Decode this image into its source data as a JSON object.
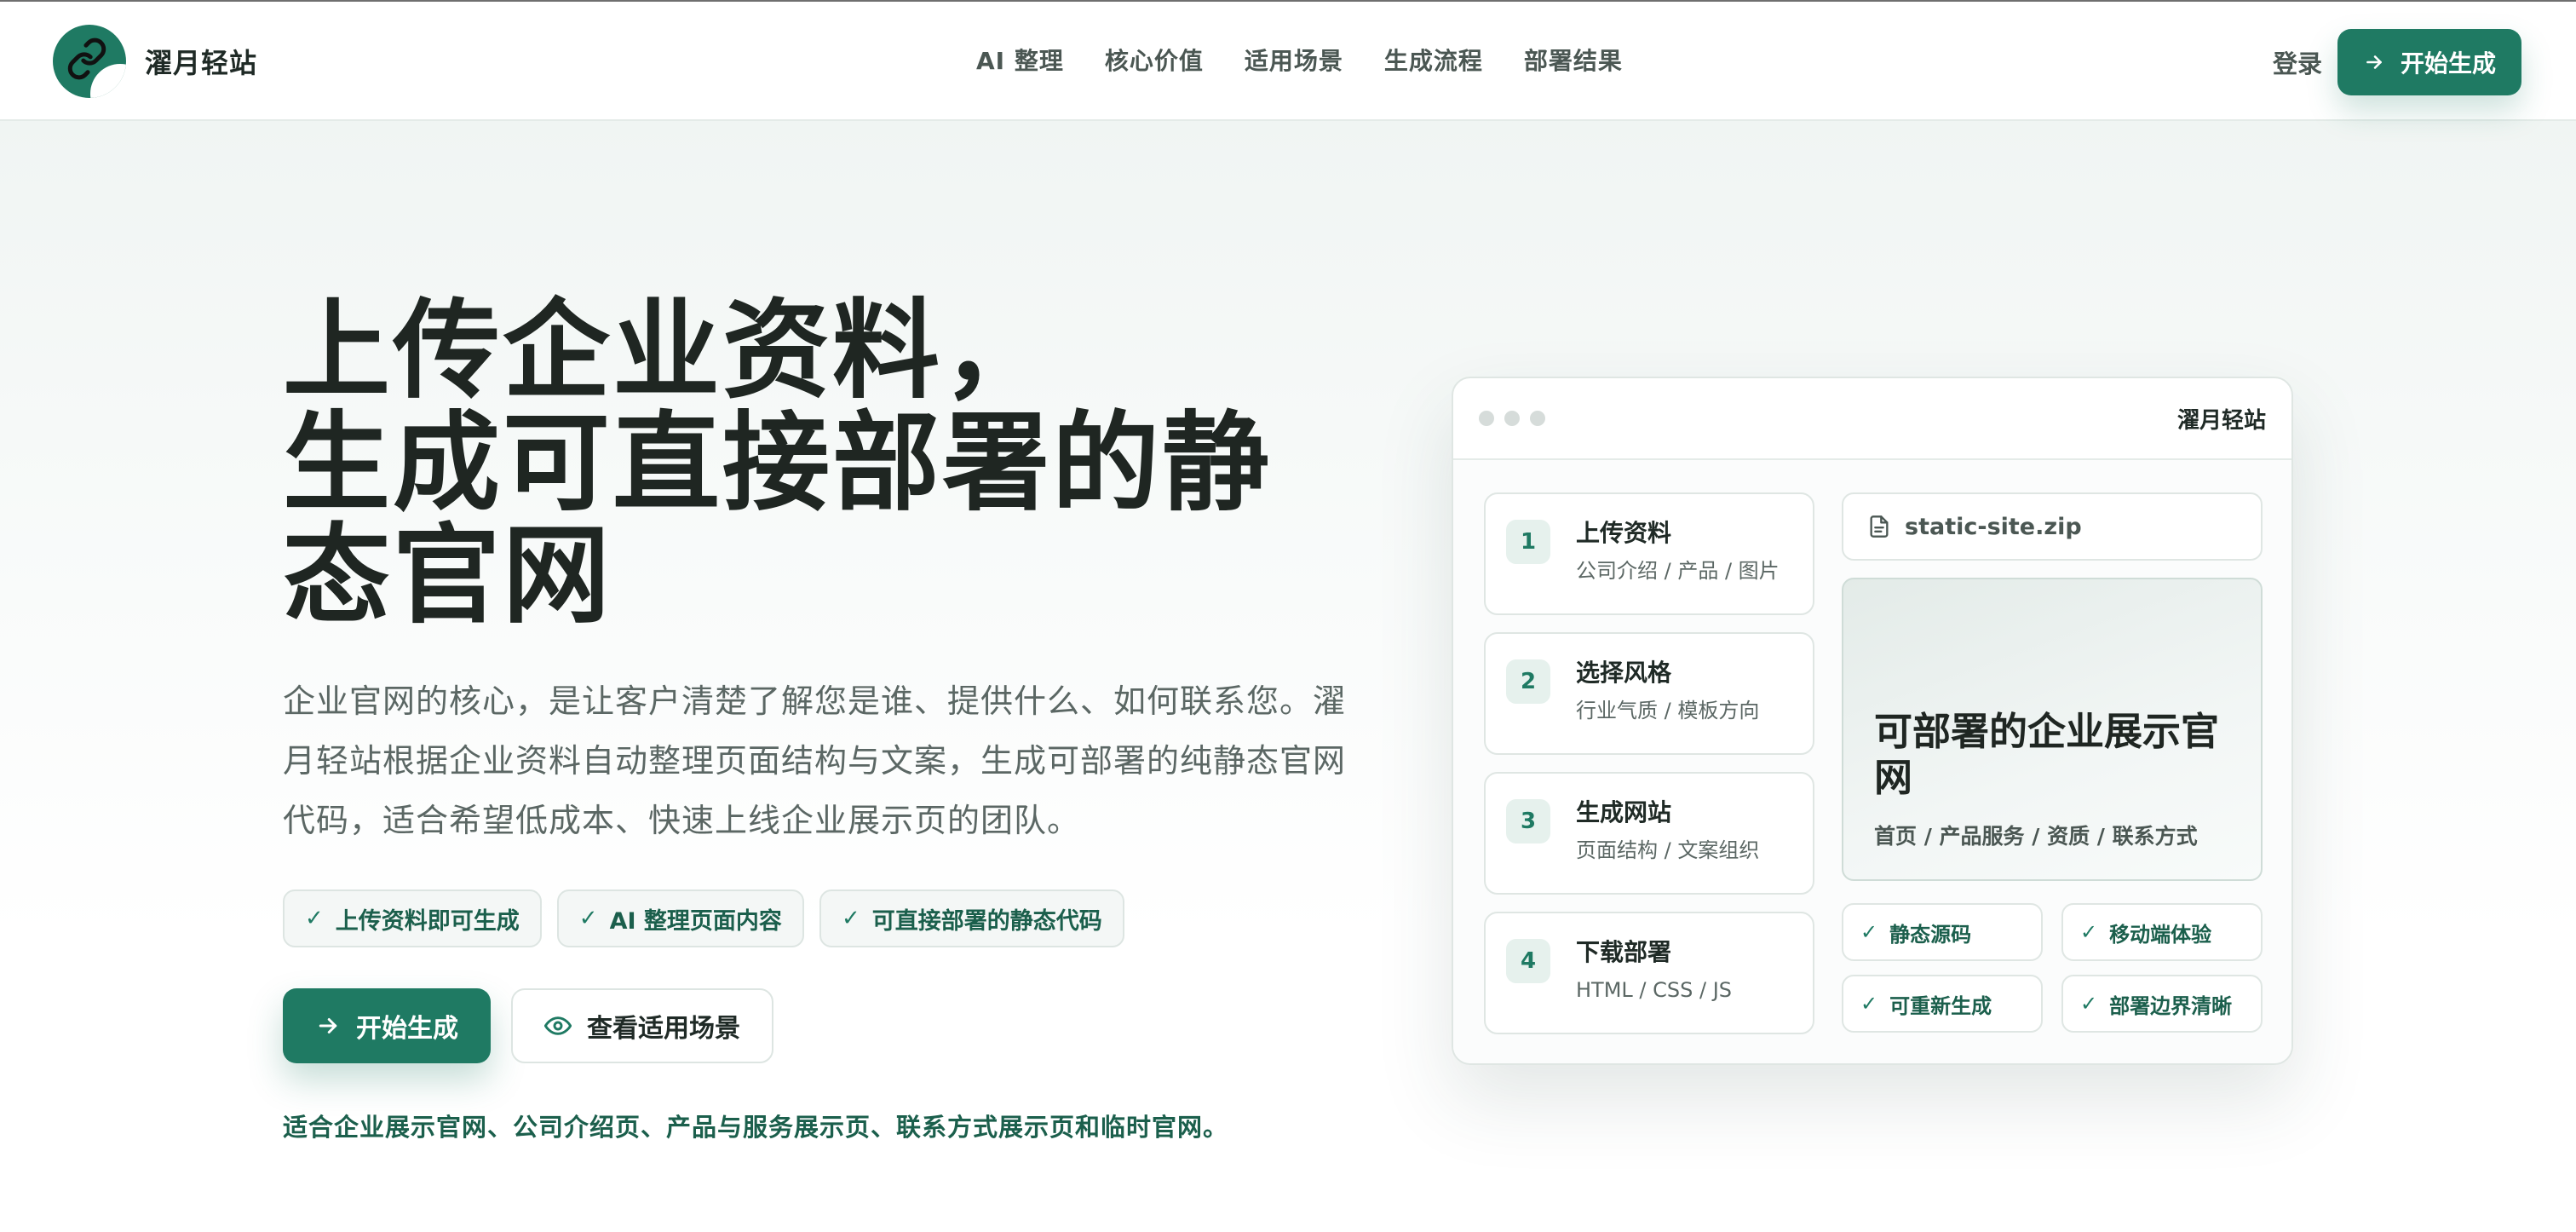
{
  "brand": {
    "name": "濯月轻站",
    "logo_icon": "link-icon",
    "color": "#1f7a63"
  },
  "nav": {
    "items": [
      {
        "label": "AI 整理"
      },
      {
        "label": "核心价值"
      },
      {
        "label": "适用场景"
      },
      {
        "label": "生成流程"
      },
      {
        "label": "部署结果"
      }
    ]
  },
  "header_actions": {
    "login_label": "登录",
    "cta_label": "开始生成",
    "cta_icon": "arrow-right-icon"
  },
  "hero": {
    "title_line1": "上传企业资料，",
    "title_line2": "生成可直接部署的静",
    "title_line3": "态官网",
    "description": "企业官网的核心，是让客户清楚了解您是谁、提供什么、如何联系您。濯月轻站根据企业资料自动整理页面结构与文案，生成可部署的纯静态官网代码，适合希望低成本、快速上线企业展示页的团队。",
    "chips": [
      {
        "label": "上传资料即可生成",
        "icon": "check-icon"
      },
      {
        "label": "AI 整理页面内容",
        "icon": "check-icon"
      },
      {
        "label": "可直接部署的静态代码",
        "icon": "check-icon"
      }
    ],
    "primary_button": "开始生成",
    "secondary_button": "查看适用场景",
    "secondary_icon": "eye-icon",
    "note": "适合企业展示官网、公司介绍页、产品与服务展示页、联系方式展示页和临时官网。"
  },
  "preview": {
    "window_title": "濯月轻站",
    "steps": [
      {
        "num": "1",
        "title": "上传资料",
        "sub": "公司介绍 / 产品 / 图片"
      },
      {
        "num": "2",
        "title": "选择风格",
        "sub": "行业气质 / 模板方向"
      },
      {
        "num": "3",
        "title": "生成网站",
        "sub": "页面结构 / 文案组织"
      },
      {
        "num": "4",
        "title": "下载部署",
        "sub": "HTML / CSS / JS"
      }
    ],
    "file_name": "static-site.zip",
    "file_icon": "document-icon",
    "site_title": "可部署的企业展示官网",
    "site_sub": "首页 / 产品服务 / 资质 / 联系方式",
    "features": [
      {
        "label": "静态源码"
      },
      {
        "label": "移动端体验"
      },
      {
        "label": "可重新生成"
      },
      {
        "label": "部署边界清晰"
      }
    ]
  }
}
